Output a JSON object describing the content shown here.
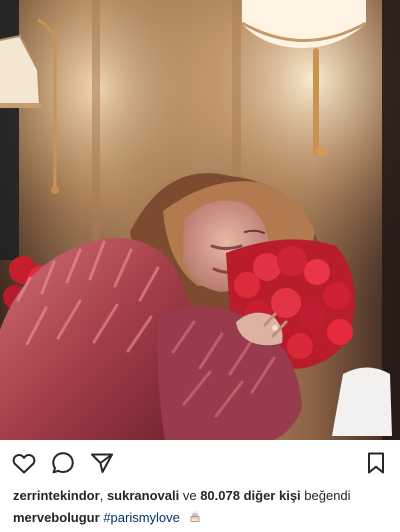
{
  "actions": {
    "like_icon": "heart-icon",
    "comment_icon": "comment-icon",
    "share_icon": "paper-plane-icon",
    "save_icon": "bookmark-icon"
  },
  "likes": {
    "user1": "zerrintekindor",
    "separator": ",",
    "user2": "sukranovali",
    "connector": "ve",
    "count": "80.078",
    "others": "diğer kişi",
    "verb": "beğendi"
  },
  "caption": {
    "username": "mervebolugur",
    "hashtag": "#parismylove",
    "emoji": "cake-emoji"
  },
  "colors": {
    "text": "#262626",
    "link": "#003569",
    "rose": "#d72a3a",
    "fur": "#b4484d",
    "lamp_shade": "#f3e6d2",
    "wall": "#9a7050"
  }
}
